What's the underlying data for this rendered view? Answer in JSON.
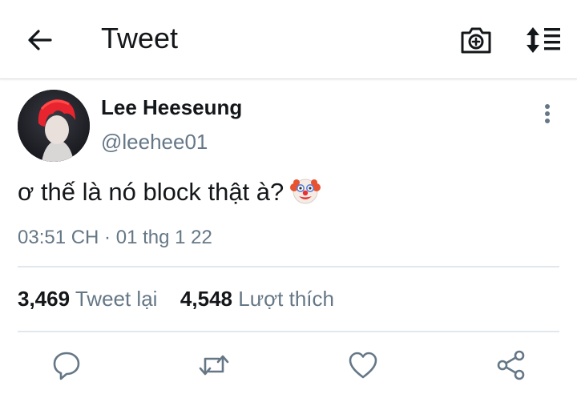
{
  "header": {
    "title": "Tweet",
    "back_icon": "arrow-left-icon",
    "camera_icon": "camera-plus-icon",
    "sort_icon": "sort-list-icon"
  },
  "tweet": {
    "author_name": "Lee Heeseung",
    "author_handle": "@leehee01",
    "text": "ơ thế là nó block thật à?",
    "emoji_icon": "clown-face-icon",
    "timestamp": "03:51 CH · 01 thg 1 22",
    "retweet_count": "3,469",
    "retweet_label": "Tweet lại",
    "like_count": "4,548",
    "like_label": "Lượt thích"
  },
  "actions": [
    "reply-icon",
    "retweet-icon",
    "like-icon",
    "share-icon"
  ],
  "colors": {
    "text": "#14171a",
    "secondary": "#657786",
    "divider": "#e1e8ed",
    "icon": "#657786"
  }
}
